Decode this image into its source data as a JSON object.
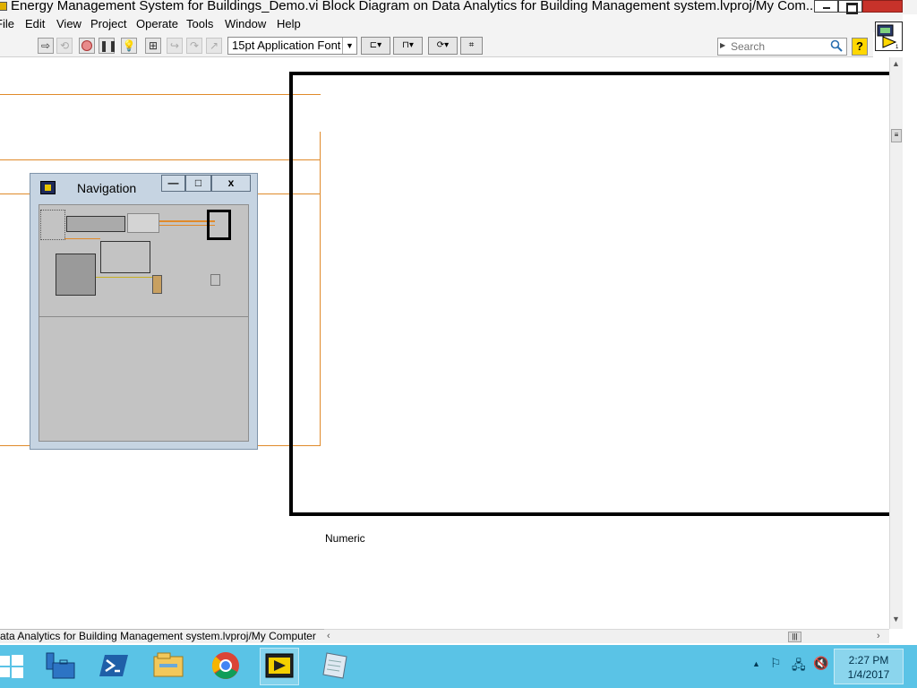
{
  "window": {
    "title": "Energy Management System for Buildings_Demo.vi Block Diagram on Data Analytics for Building Management system.lvproj/My Com..."
  },
  "menu": {
    "items": [
      "File",
      "Edit",
      "View",
      "Project",
      "Operate",
      "Tools",
      "Window",
      "Help"
    ]
  },
  "toolbar": {
    "font_select_label": "15pt Application Font",
    "search_placeholder": "Search",
    "help_label": "?"
  },
  "canvas": {
    "numeric_label": "Numeric"
  },
  "navigation_window": {
    "title": "Navigation",
    "min_label": "—",
    "max_label": "□",
    "close_label": "x"
  },
  "statusbar": {
    "text": "ata Analytics for Building Management system.lvproj/My Computer"
  },
  "taskbar": {
    "time": "2:27 PM",
    "date": "1/4/2017"
  },
  "colors": {
    "wire": "#e08a2a",
    "taskbar": "#5ac3e6",
    "close_button": "#c7322a"
  }
}
